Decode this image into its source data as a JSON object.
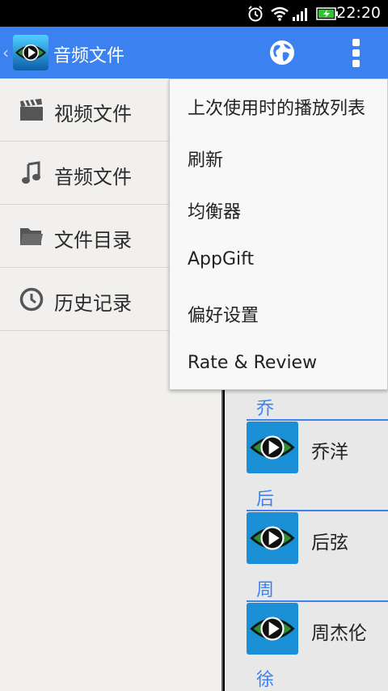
{
  "status_bar": {
    "time": "22:20",
    "icons": [
      "alarm-icon",
      "wifi-icon",
      "signal-icon",
      "battery-charging-icon"
    ]
  },
  "action_bar": {
    "title": "音频文件",
    "back_glyph": "‹",
    "logo_icon": "eye-play-logo-icon",
    "globe_icon": "globe-icon",
    "overflow_icon": "overflow-menu-icon",
    "color": "#3b82f0"
  },
  "drawer": {
    "items": [
      {
        "label": "视频文件",
        "icon": "clapperboard-icon"
      },
      {
        "label": "音频文件",
        "icon": "music-note-icon"
      },
      {
        "label": "文件目录",
        "icon": "folder-icon"
      },
      {
        "label": "历史记录",
        "icon": "clock-icon"
      }
    ]
  },
  "popup_menu": {
    "items": [
      {
        "label": "上次使用时的播放列表"
      },
      {
        "label": "刷新"
      },
      {
        "label": "均衡器"
      },
      {
        "label": "AppGift"
      },
      {
        "label": "偏好设置"
      },
      {
        "label": "Rate & Review"
      }
    ]
  },
  "artist_list": {
    "sections": [
      {
        "header": "乔",
        "artist": "乔洋"
      },
      {
        "header": "后",
        "artist": "后弦"
      },
      {
        "header": "周",
        "artist": "周杰伦"
      },
      {
        "header": "徐",
        "artist": ""
      }
    ],
    "accent": "#3b82f0"
  }
}
